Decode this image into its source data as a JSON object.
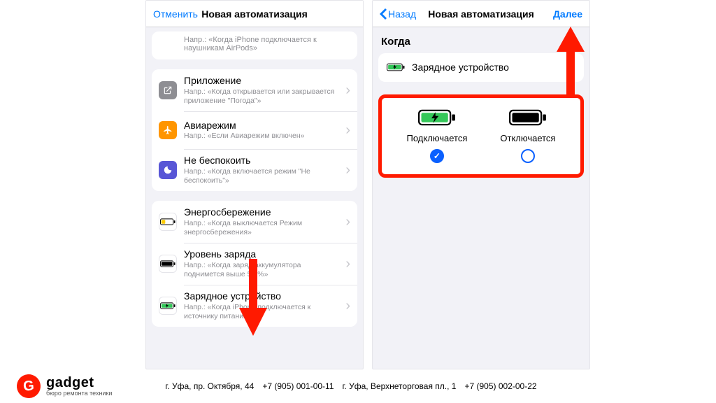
{
  "left": {
    "cancel": "Отменить",
    "title": "Новая автоматизация",
    "partial_hint": "Напр.: «Когда iPhone подключается к наушникам AirPods»",
    "group1": [
      {
        "title": "Приложение",
        "sub": "Напр.: «Когда открывается или закрывается приложение \"Погода\"»",
        "icon": "app"
      },
      {
        "title": "Авиарежим",
        "sub": "Напр.: «Если Авиарежим включен»",
        "icon": "airplane"
      },
      {
        "title": "Не беспокоить",
        "sub": "Напр.: «Когда включается режим \"Не беспокоить\"»",
        "icon": "moon"
      }
    ],
    "group2": [
      {
        "title": "Энергосбережение",
        "sub": "Напр.: «Когда выключается Режим энергосбережения»",
        "icon": "batt-yellow"
      },
      {
        "title": "Уровень заряда",
        "sub": "Напр.: «Когда заряд аккумулятора поднимется выше 50 %»",
        "icon": "batt-black"
      },
      {
        "title": "Зарядное устройство",
        "sub": "Напр.: «Когда iPhone подключается к источнику питания»",
        "icon": "batt-green"
      }
    ]
  },
  "right": {
    "back": "Назад",
    "title": "Новая автоматизация",
    "next": "Далее",
    "when_heading": "Когда",
    "when_value": "Зарядное устройство",
    "choice_connect": "Подключается",
    "choice_disconnect": "Отключается",
    "selected": "connect"
  },
  "footer": {
    "brand": "gadget",
    "tagline": "бюро ремонта техники",
    "addr1": "г. Уфа, пр. Октября, 44",
    "phone1": "+7 (905) 001-00-11",
    "addr2": "г. Уфа, Верхнеторговая пл., 1",
    "phone2": "+7 (905) 002-00-22"
  }
}
